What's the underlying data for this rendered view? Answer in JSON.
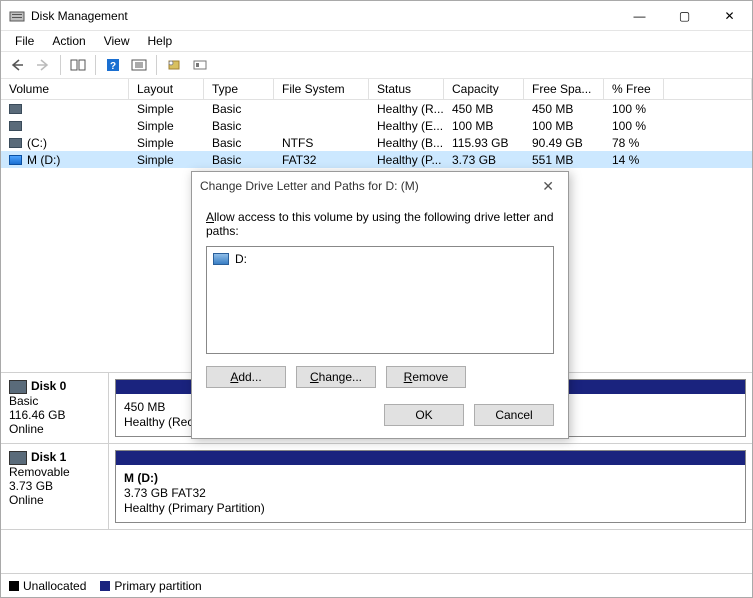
{
  "window": {
    "title": "Disk Management",
    "controls": {
      "min": "—",
      "max": "▢",
      "close": "✕"
    }
  },
  "menu": {
    "items": [
      "File",
      "Action",
      "View",
      "Help"
    ]
  },
  "toolbar": {
    "icons": [
      "back-icon",
      "forward-icon",
      "sep",
      "showhide-icon",
      "sep",
      "help-icon",
      "refresh-icon",
      "sep",
      "properties-icon",
      "options-icon"
    ]
  },
  "volumeTable": {
    "headers": [
      "Volume",
      "Layout",
      "Type",
      "File System",
      "Status",
      "Capacity",
      "Free Spa...",
      "% Free"
    ],
    "rows": [
      {
        "volume": "",
        "layout": "Simple",
        "type": "Basic",
        "fs": "",
        "status": "Healthy (R...",
        "cap": "450 MB",
        "free": "450 MB",
        "pfree": "100 %",
        "selected": false,
        "iconBlue": false
      },
      {
        "volume": "",
        "layout": "Simple",
        "type": "Basic",
        "fs": "",
        "status": "Healthy (E...",
        "cap": "100 MB",
        "free": "100 MB",
        "pfree": "100 %",
        "selected": false,
        "iconBlue": false
      },
      {
        "volume": " (C:)",
        "layout": "Simple",
        "type": "Basic",
        "fs": "NTFS",
        "status": "Healthy (B...",
        "cap": "115.93 GB",
        "free": "90.49 GB",
        "pfree": "78 %",
        "selected": false,
        "iconBlue": false
      },
      {
        "volume": "M (D:)",
        "layout": "Simple",
        "type": "Basic",
        "fs": "FAT32",
        "status": "Healthy (P...",
        "cap": "3.73 GB",
        "free": "551 MB",
        "pfree": "14 %",
        "selected": true,
        "iconBlue": true
      }
    ]
  },
  "disks": [
    {
      "name": "Disk 0",
      "kind": "Basic",
      "size": "116.46 GB",
      "state": "Online",
      "partitions": [
        {
          "title": "",
          "line1": "450 MB",
          "line2": "Healthy (Recovery                                          h Dump, Primary Partition)"
        }
      ]
    },
    {
      "name": "Disk 1",
      "kind": "Removable",
      "size": "3.73 GB",
      "state": "Online",
      "partitions": [
        {
          "title": "M  (D:)",
          "line1": "3.73 GB FAT32",
          "line2": "Healthy (Primary Partition)"
        }
      ]
    }
  ],
  "legend": {
    "unalloc": "Unallocated",
    "primary": "Primary partition"
  },
  "dialog": {
    "title": "Change Drive Letter and Paths for D: (M)",
    "instruction_pre": "A",
    "instruction": "llow access to this volume by using the following drive letter and paths:",
    "listItems": [
      {
        "label": "D:"
      }
    ],
    "buttons": {
      "add": "Add...",
      "change": "Change...",
      "remove": "Remove",
      "ok": "OK",
      "cancel": "Cancel"
    }
  }
}
